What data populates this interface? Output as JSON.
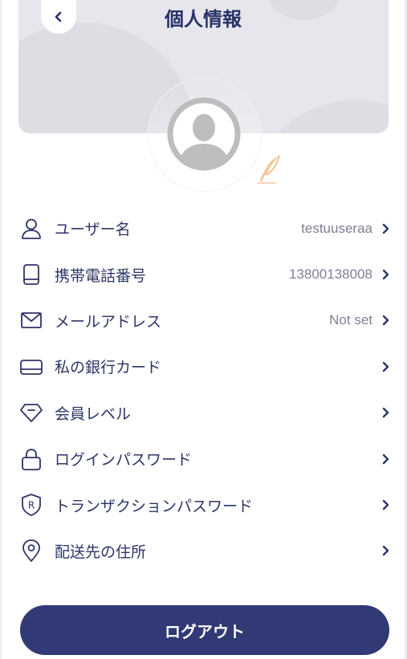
{
  "header": {
    "title": "個人情報"
  },
  "menu": {
    "items": [
      {
        "icon": "user-icon",
        "label": "ユーザー名",
        "value": "testuuseraa"
      },
      {
        "icon": "phone-icon",
        "label": "携帯電話番号",
        "value": "13800138008"
      },
      {
        "icon": "mail-icon",
        "label": "メールアドレス",
        "value": "Not set"
      },
      {
        "icon": "card-icon",
        "label": "私の銀行カード",
        "value": ""
      },
      {
        "icon": "diamond-icon",
        "label": "会員レベル",
        "value": ""
      },
      {
        "icon": "lock-icon",
        "label": "ログインパスワード",
        "value": ""
      },
      {
        "icon": "shield-icon",
        "label": "トランザクションパスワード",
        "value": ""
      },
      {
        "icon": "location-pin-icon",
        "label": "配送先の住所",
        "value": ""
      }
    ]
  },
  "logout": {
    "label": "ログアウト"
  },
  "colors": {
    "primary": "#313a74",
    "text": "#2d3566",
    "value": "#7e7e97",
    "accent": "#f5c89a"
  }
}
